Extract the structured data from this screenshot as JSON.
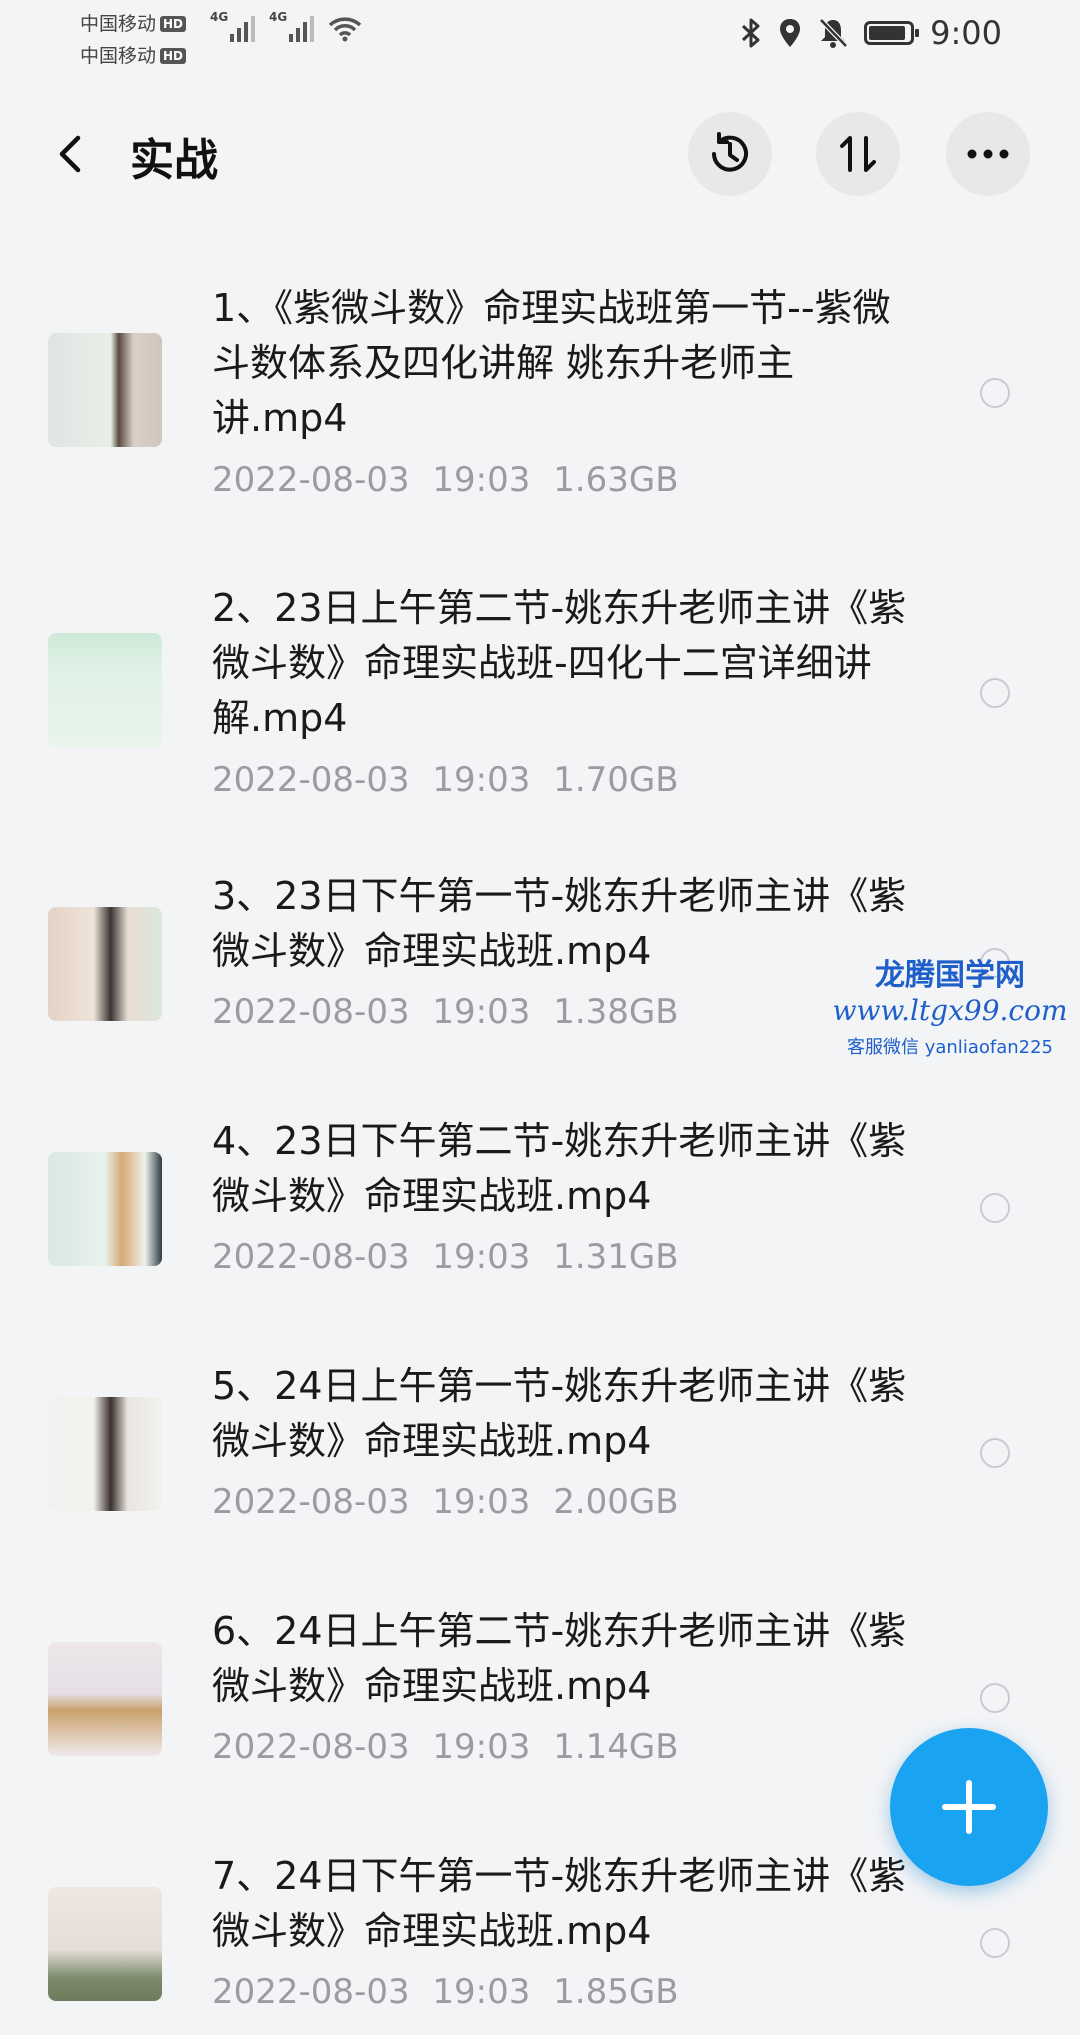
{
  "status_bar": {
    "carrier1": "中国移动",
    "carrier2": "中国移动",
    "hd_badge": "HD",
    "network_type": "4G",
    "time": "9:00",
    "icons": [
      "bluetooth-icon",
      "location-icon",
      "mute-icon",
      "battery-icon"
    ]
  },
  "header": {
    "title": "实战",
    "buttons": [
      "history-icon",
      "sort-icon",
      "more-icon"
    ]
  },
  "files": [
    {
      "name": "1、《紫微斗数》命理实战班第一节--紫微斗数体系及四化讲解 姚东升老师主讲.mp4",
      "date": "2022-08-03",
      "time": "19:03",
      "size": "1.63GB"
    },
    {
      "name": "2、23日上午第二节-姚东升老师主讲《紫微斗数》命理实战班-四化十二宫详细讲解.mp4",
      "date": "2022-08-03",
      "time": "19:03",
      "size": "1.70GB"
    },
    {
      "name": "3、23日下午第一节-姚东升老师主讲《紫微斗数》命理实战班.mp4",
      "date": "2022-08-03",
      "time": "19:03",
      "size": "1.38GB"
    },
    {
      "name": "4、23日下午第二节-姚东升老师主讲《紫微斗数》命理实战班.mp4",
      "date": "2022-08-03",
      "time": "19:03",
      "size": "1.31GB"
    },
    {
      "name": "5、24日上午第一节-姚东升老师主讲《紫微斗数》命理实战班.mp4",
      "date": "2022-08-03",
      "time": "19:03",
      "size": "2.00GB"
    },
    {
      "name": "6、24日上午第二节-姚东升老师主讲《紫微斗数》命理实战班.mp4",
      "date": "2022-08-03",
      "time": "19:03",
      "size": "1.14GB"
    },
    {
      "name": "7、24日下午第一节-姚东升老师主讲《紫微斗数》命理实战班.mp4",
      "date": "2022-08-03",
      "time": "19:03",
      "size": "1.85GB"
    }
  ],
  "watermark": {
    "line1": "龙腾国学网",
    "line2": "www.ltgx99.com",
    "line3": "客服微信 yanliaofan225"
  },
  "fab": {
    "icon": "plus-icon"
  },
  "colors": {
    "background": "#f3f4f6",
    "fab": "#1aa3f0",
    "meta_text": "#9a9ca0",
    "watermark": "#1e5fc9"
  }
}
